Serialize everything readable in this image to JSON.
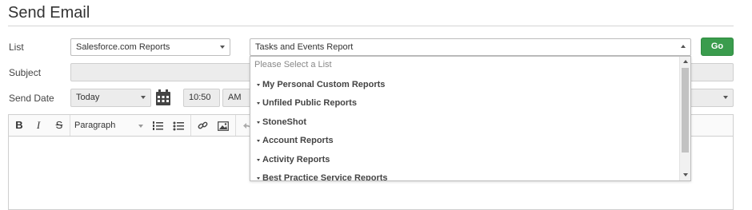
{
  "page": {
    "title": "Send Email"
  },
  "form": {
    "list_label": "List",
    "list_value": "Salesforce.com Reports",
    "report_value": "Tasks and Events Report",
    "go_label": "Go",
    "subject_label": "Subject",
    "subject_value": "",
    "send_date_label": "Send Date",
    "send_date_value": "Today",
    "time_value": "10:50",
    "ampm_value": "AM"
  },
  "editor": {
    "toolbar": {
      "bold": "B",
      "italic": "I",
      "strike": "S",
      "format_value": "Paragraph"
    }
  },
  "dropdown": {
    "placeholder": "Please Select a List",
    "items": [
      "My Personal Custom Reports",
      "Unfiled Public Reports",
      "StoneShot",
      "Account Reports",
      "Activity Reports",
      "Best Practice Service Reports"
    ]
  },
  "colors": {
    "go_button": "#3a9c4d"
  }
}
